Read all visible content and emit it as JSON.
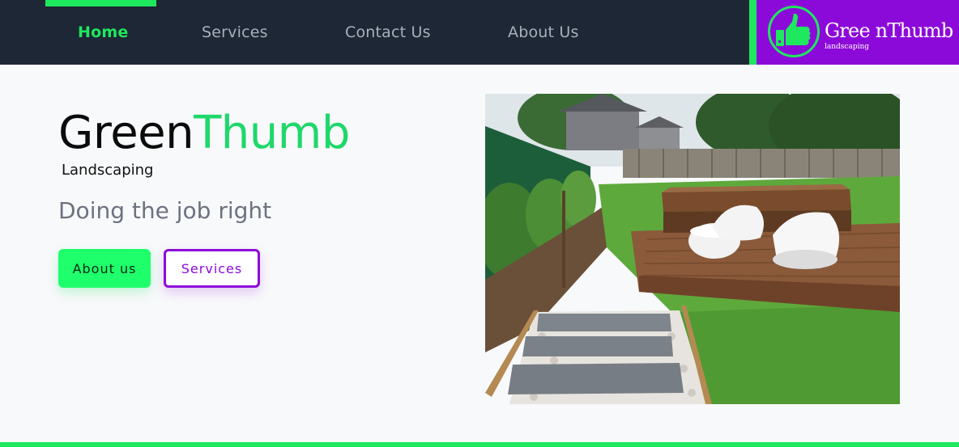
{
  "nav": {
    "items": [
      {
        "label": "Home",
        "active": true
      },
      {
        "label": "Services",
        "active": false
      },
      {
        "label": "Contact Us",
        "active": false
      },
      {
        "label": "About Us",
        "active": false
      }
    ],
    "indicator_color": "#1ee85e",
    "background": "#1e2735"
  },
  "logo": {
    "title": "Gree nThumb",
    "subtitle": "landscaping",
    "icon": "thumbs-up-icon",
    "background": "#8c0ad9",
    "accent": "#1ee85e"
  },
  "hero": {
    "title_part1": "Green",
    "title_part2": "Thumb",
    "subtitle": "Landscaping",
    "tagline": "Doing the job right",
    "buttons": {
      "about_label": "About us",
      "services_label": "Services"
    },
    "image_alt": "Garden with timber deck, white seats and stepping stones"
  },
  "colors": {
    "primary_green": "#1ee85e",
    "purple": "#8c0ad9",
    "gray_text": "#6d7280"
  }
}
